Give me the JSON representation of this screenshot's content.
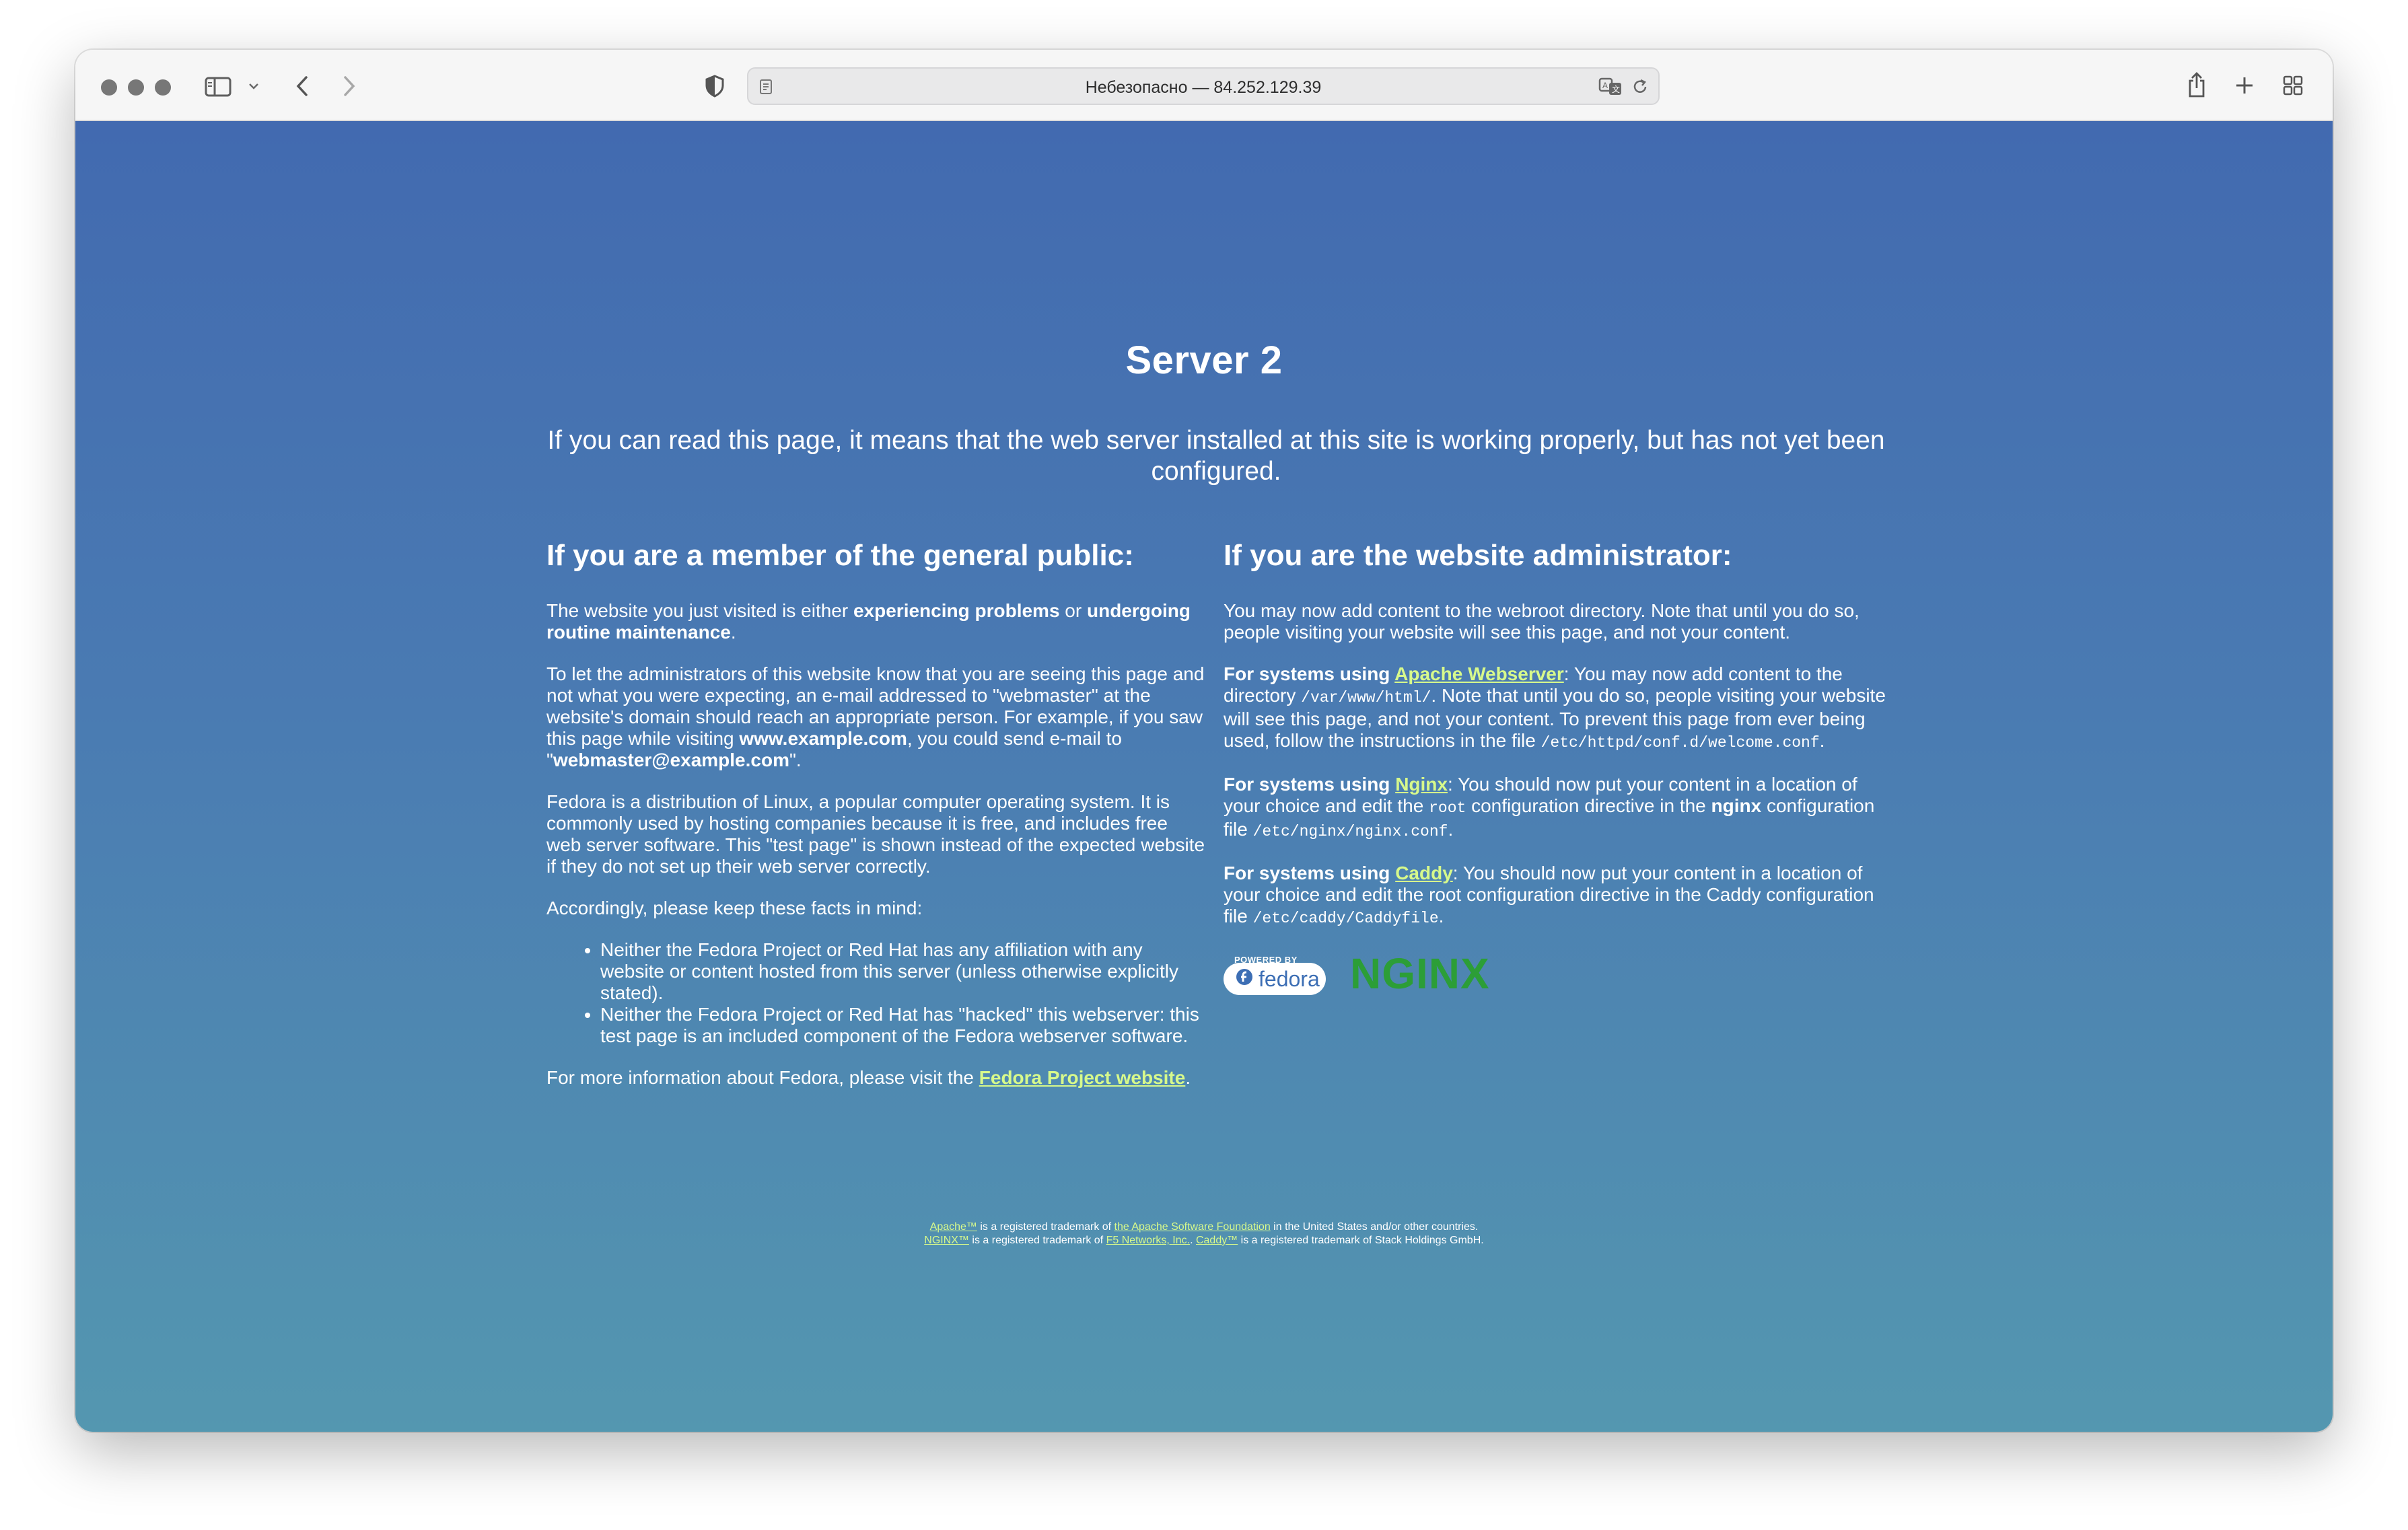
{
  "browser": {
    "address_text": "Небезопасно — 84.252.129.39"
  },
  "page": {
    "title": "Server 2",
    "intro": "If you can read this page, it means that the web server installed at this site is working properly, but has not yet been configured.",
    "public": {
      "heading": "If you are a member of the general public:",
      "p1_a": "The website you just visited is either ",
      "p1_b": "experiencing problems",
      "p1_c": " or ",
      "p1_d": "undergoing routine maintenance",
      "p1_e": ".",
      "p2_a": "To let the administrators of this website know that you are seeing this page and not what you were expecting, an e-mail addressed to \"webmaster\" at the website's domain should reach an appropriate person. For example, if you saw this page while visiting ",
      "p2_b": "www.example.com",
      "p2_c": ", you could send e-mail to \"",
      "p2_d": "webmaster@example.com",
      "p2_e": "\".",
      "p3": "Fedora is a distribution of Linux, a popular computer operating system. It is commonly used by hosting companies because it is free, and includes free web server software. This \"test page\" is shown instead of the expected website if they do not set up their web server correctly.",
      "p4": "Accordingly, please keep these facts in mind:",
      "bullets": [
        "Neither the Fedora Project or Red Hat has any affiliation with any website or content hosted from this server (unless otherwise explicitly stated).",
        "Neither the Fedora Project or Red Hat has \"hacked\" this webserver: this test page is an included component of the Fedora webserver software."
      ],
      "p5_a": "For more information about Fedora, please visit the ",
      "p5_link": "Fedora Project website",
      "p5_b": "."
    },
    "admin": {
      "heading": "If you are the website administrator:",
      "p1": "You may now add content to the webroot directory. Note that until you do so, people visiting your website will see this page, and not your content.",
      "apache_prefix": "For systems using ",
      "apache_link": "Apache Webserver",
      "apache_a": ": You may now add content to the directory ",
      "apache_code1": "/var/www/html/",
      "apache_b": ". Note that until you do so, people visiting your website will see this page, and not your content. To prevent this page from ever being used, follow the instructions in the file ",
      "apache_code2": "/etc/httpd/conf.d/welcome.conf",
      "apache_c": ".",
      "nginx_prefix": "For systems using ",
      "nginx_link": "Nginx",
      "nginx_a": ": You should now put your content in a location of your choice and edit the ",
      "nginx_code1": "root",
      "nginx_b": " configuration directive in the ",
      "nginx_bold": "nginx",
      "nginx_c": " configuration file ",
      "nginx_code2": "/etc/nginx/nginx.conf",
      "nginx_d": ".",
      "caddy_prefix": "For systems using ",
      "caddy_link": "Caddy",
      "caddy_a": ": You should now put your content in a location of your choice and edit the root configuration directive in the Caddy configuration file ",
      "caddy_code": "/etc/caddy/Caddyfile",
      "caddy_b": "."
    },
    "logos": {
      "powered_by": "POWERED BY",
      "fedora": "fedora",
      "nginx": "NGINX"
    },
    "footer": {
      "l1_link1": "Apache™",
      "l1_a": " is a registered trademark of ",
      "l1_link2": "the Apache Software Foundation",
      "l1_b": " in the United States and/or other countries.",
      "l2_link1": "NGINX™",
      "l2_a": " is a registered trademark of ",
      "l2_link2": "F5 Networks, Inc.",
      "l2_b": ". ",
      "l2_link3": "Caddy™",
      "l2_c": " is a registered trademark of Stack Holdings GmbH."
    }
  },
  "colors": {
    "link": "#d7f98b",
    "bg_top": "#426ab0",
    "bg_bottom": "#5497b0",
    "nginx_green": "#2c9e37"
  }
}
